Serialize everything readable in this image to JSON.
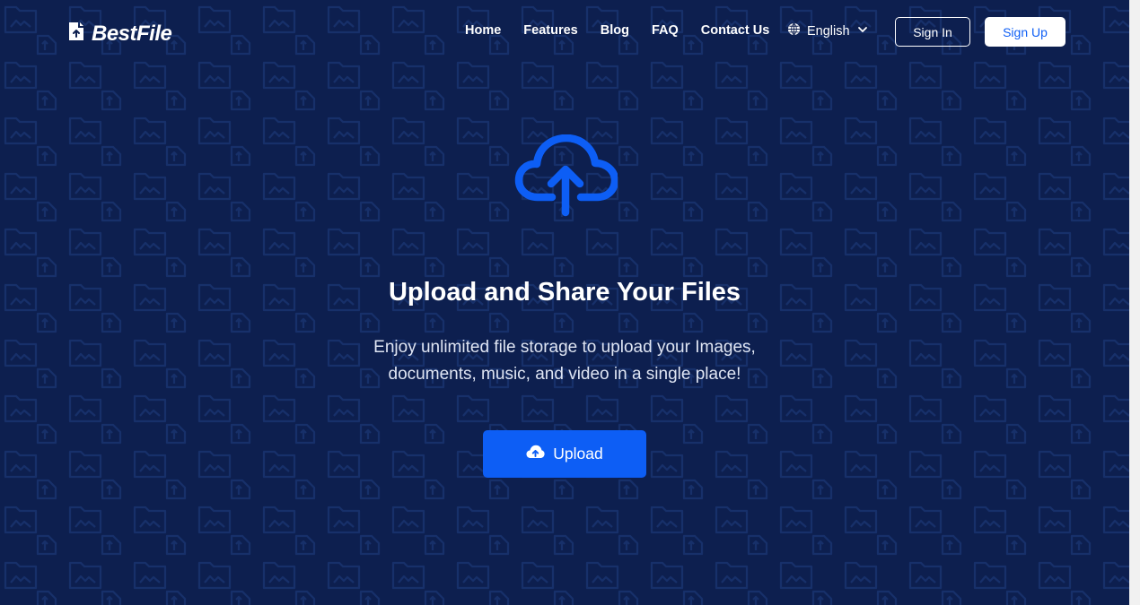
{
  "brand": {
    "name": "BestFile",
    "logo_icon": "file-upload-icon"
  },
  "nav": {
    "links": [
      "Home",
      "Features",
      "Blog",
      "FAQ",
      "Contact Us"
    ],
    "language": {
      "label": "English",
      "icon": "globe-icon",
      "caret_icon": "chevron-down-icon"
    },
    "sign_in": "Sign In",
    "sign_up": "Sign Up"
  },
  "hero": {
    "icon": "cloud-upload-icon",
    "title": "Upload and Share Your Files",
    "subtitle": "Enjoy unlimited file storage to upload your Images, documents, music, and video in a single place!",
    "upload_button": {
      "label": "Upload",
      "icon": "cloud-upload-icon"
    }
  },
  "colors": {
    "background": "#0d1f4f",
    "accent": "#0d5ef5",
    "text": "#ffffff"
  }
}
